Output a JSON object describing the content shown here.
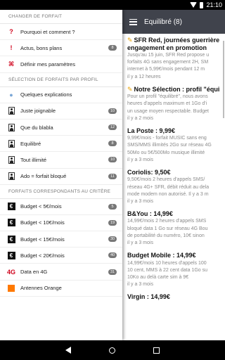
{
  "status": {
    "time": "21:10"
  },
  "drawer": {
    "sections": [
      {
        "title": "CHANGER DE FORFAIT",
        "items": [
          {
            "label": "Pourquoi et comment ?",
            "icon": "question-icon",
            "glyph": "?",
            "badge": ""
          },
          {
            "label": "Actus, bons plans",
            "icon": "exclamation-icon",
            "glyph": "!",
            "badge": "8"
          },
          {
            "label": "Définir mes paramètres",
            "icon": "command-icon",
            "glyph": "⌘",
            "badge": ""
          }
        ]
      },
      {
        "title": "SÉLECTION DE FORFAITS PAR PROFIL",
        "items": [
          {
            "label": "Quelques explications",
            "icon": "lightbulb-icon",
            "glyph": "💡",
            "badge": ""
          },
          {
            "label": "Juste joignable",
            "icon": "person-icon",
            "glyph": "",
            "badge": "10"
          },
          {
            "label": "Que du blabla",
            "icon": "person-icon",
            "glyph": "",
            "badge": "12"
          },
          {
            "label": "Equilibré",
            "icon": "person-icon",
            "glyph": "",
            "badge": "8"
          },
          {
            "label": "Tout illimité",
            "icon": "person-icon",
            "glyph": "",
            "badge": "10"
          },
          {
            "label": "Ado = forfait bloqué",
            "icon": "person-icon",
            "glyph": "",
            "badge": "11"
          }
        ]
      },
      {
        "title": "FORFAITS CORRESPONDANTS AU CRITÈRE",
        "items": [
          {
            "label": "Budget < 5€/mois",
            "icon": "euro-icon",
            "glyph": "€",
            "badge": "5"
          },
          {
            "label": "Budget < 10€/mois",
            "icon": "euro-icon",
            "glyph": "€",
            "badge": "19"
          },
          {
            "label": "Budget < 15€/mois",
            "icon": "euro-icon",
            "glyph": "€",
            "badge": "30"
          },
          {
            "label": "Budget < 20€/mois",
            "icon": "euro-icon",
            "glyph": "€",
            "badge": "40"
          },
          {
            "label": "Data en 4G",
            "icon": "4g-icon",
            "glyph": "4G",
            "badge": "31"
          },
          {
            "label": "Antennes Orange",
            "icon": "orange-square-icon",
            "glyph": "",
            "badge": ""
          }
        ]
      }
    ]
  },
  "appbar": {
    "title": "Equilibré (8)"
  },
  "feed": [
    {
      "title_lines": [
        "SFR Red, journées guerrière",
        "engagement en promotion"
      ],
      "tag": true,
      "body_lines": [
        "Jusqu'au 15 juin, SFR Red propose u",
        "forfaits 4G sans engagement 2H, SM",
        "internet à 5,99€/mois pendant 12 m"
      ],
      "time": "il y a 12 heures"
    },
    {
      "title_lines": [
        "Notre Sélection : profil \"équi"
      ],
      "tag": true,
      "body_lines": [
        "Pour un profil \"équilibré\", nous avons",
        "heures d'appels maximum et 1Go d'i",
        "un usage moyen respectable. Budget"
      ],
      "time": "il y a 2 mois"
    },
    {
      "title_lines": [
        "La Poste : 9,99€"
      ],
      "tag": false,
      "body_lines": [
        "9,99€/mois - forfait MUSIC sans eng",
        "SMS/MMS illimités 2Go sur réseau 4G",
        "50Mo ou 5€/500Mo musique illimité"
      ],
      "time": "il y a 3 mois"
    },
    {
      "title_lines": [
        "Coriolis: 9,50€"
      ],
      "tag": false,
      "body_lines": [
        "9,50€/mois 2 heures d'appels SMS/",
        "réseau 4G+ SFR, débit réduit au dela",
        "mode modem non autorisé. Il y a 3 m"
      ],
      "time": "il y a 3 mois"
    },
    {
      "title_lines": [
        "B&You : 14,99€"
      ],
      "tag": false,
      "body_lines": [
        "14,99€/mois 2 heures d'appels SMS",
        "bloqué data 1 Go sur réseau 4G Bou",
        "de portabilité du numéro, 10€ sinon"
      ],
      "time": "il y a 3 mois"
    },
    {
      "title_lines": [
        "Budget Mobile : 14,99€"
      ],
      "tag": false,
      "body_lines": [
        "14,99€/mois 10 heures d'appels 100",
        "10 cent, MMS à 22 cent data 1Go su",
        "10Ko au delà carte sim à 9€"
      ],
      "time": "il y a 3 mois"
    },
    {
      "title_lines": [
        "Virgin : 14,99€"
      ],
      "tag": false,
      "body_lines": [],
      "time": ""
    }
  ]
}
